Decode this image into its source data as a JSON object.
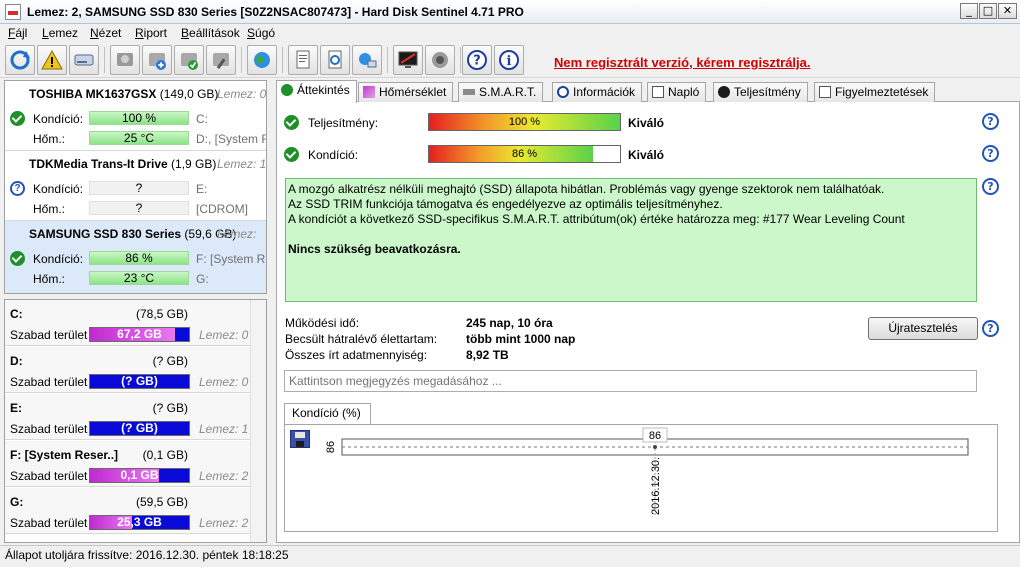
{
  "window": {
    "title": "Lemez: 2, SAMSUNG SSD 830 Series [S0Z2NSAC807473] - Hard Disk Sentinel 4.71 PRO",
    "btn_min": "_",
    "btn_max": "□",
    "btn_close": "✕"
  },
  "menu": [
    {
      "first": "F",
      "rest": "ájl"
    },
    {
      "first": "L",
      "rest": "emez"
    },
    {
      "first": "N",
      "rest": "ézet"
    },
    {
      "first": "R",
      "rest": "iport"
    },
    {
      "first": "B",
      "rest": "eállítások"
    },
    {
      "first": "S",
      "rest": "úgó"
    }
  ],
  "toolbar": {
    "icons": [
      "refresh-icon",
      "warning-icon",
      "disk-icon",
      "hdd-gray-icon",
      "hdd-add-icon",
      "hdd-ok-icon",
      "hdd-tool-icon",
      "globe-icon",
      "report-icon",
      "report-refresh-icon",
      "network-icon",
      "monitor-icon",
      "speaker-icon",
      "help-icon",
      "info-icon"
    ],
    "registration_warning": "Nem regisztrált verzió, kérem regisztrálja."
  },
  "disks": [
    {
      "name": "TOSHIBA MK1637GSX",
      "size": "(149,0 GB)",
      "lemez": "Lemez: 0",
      "status": "ok",
      "kondicio_label": "Kondíció:",
      "kondicio_value": "100 %",
      "hom_label": "Hőm.:",
      "hom_value": "25 °C",
      "drive1": "C:",
      "drive2": "D:, [System R"
    },
    {
      "name": "TDKMedia Trans-It Drive",
      "size": "(1,9 GB)",
      "lemez": "Lemez: 1",
      "status": "unknown",
      "kondicio_label": "Kondíció:",
      "kondicio_value": "?",
      "hom_label": "Hőm.:",
      "hom_value": "?",
      "drive1": "E:",
      "drive2": "[CDROM]"
    },
    {
      "name": "SAMSUNG SSD 830 Series",
      "size": "(59,6 GB)",
      "lemez": "Lemez:",
      "status": "ok",
      "kondicio_label": "Kondíció:",
      "kondicio_value": "86 %",
      "hom_label": "Hőm.:",
      "hom_value": "23 °C",
      "drive1": "F: [System Res",
      "drive2": "G:"
    }
  ],
  "partitions": [
    {
      "letter": "C:",
      "size": "(78,5 GB)",
      "free_label": "Szabad terület",
      "free_value": "67,2 GB",
      "fill": 0.86,
      "lemez": "Lemez: 0"
    },
    {
      "letter": "D:",
      "size": "(? GB)",
      "free_label": "Szabad terület",
      "free_value": "(? GB)",
      "fill": 0,
      "lemez": "Lemez: 0"
    },
    {
      "letter": "E:",
      "size": "(? GB)",
      "free_label": "Szabad terület",
      "free_value": "(? GB)",
      "fill": 0,
      "lemez": "Lemez: 1"
    },
    {
      "letter": "F: [System Reser..]",
      "size": "(0,1 GB)",
      "free_label": "Szabad terület",
      "free_value": "0,1 GB",
      "fill": 0.7,
      "lemez": "Lemez: 2"
    },
    {
      "letter": "G:",
      "size": "(59,5 GB)",
      "free_label": "Szabad terület",
      "free_value": "25,3 GB",
      "fill": 0.42,
      "lemez": "Lemez: 2"
    }
  ],
  "status_bar": "Állapot utoljára frissítve: 2016.12.30. péntek 18:18:25",
  "tabs": [
    {
      "label": "Áttekintés",
      "icon": "check-icon"
    },
    {
      "label": "Hőmérséklet",
      "icon": "thermometer-icon"
    },
    {
      "label": "S.M.A.R.T.",
      "icon": "smart-icon"
    },
    {
      "label": "Információk",
      "icon": "info-icon"
    },
    {
      "label": "Napló",
      "icon": "log-icon"
    },
    {
      "label": "Teljesítmény",
      "icon": "speed-icon"
    },
    {
      "label": "Figyelmeztetések",
      "icon": "alerts-icon"
    }
  ],
  "overview": {
    "performance_label": "Teljesítmény:",
    "performance_value": "100 %",
    "performance_fill": 1.0,
    "performance_rating": "Kiváló",
    "condition_label": "Kondíció:",
    "condition_value": "86 %",
    "condition_fill": 0.86,
    "condition_rating": "Kiváló",
    "description": [
      "A mozgó alkatrész nélküli meghajtó (SSD) állapota hibátlan. Problémás vagy gyenge szektorok nem találhatóak.",
      "Az SSD TRIM funkciója támogatva és engedélyezve az optimális teljesítményhez.",
      "A kondíciót a következő SSD-specifikus S.M.A.R.T. attribútum(ok) értéke határozza meg:  #177 Wear Leveling Count"
    ],
    "action": "Nincs szükség beavatkozásra.",
    "uptime_label": "Működési idő:",
    "uptime_value": "245 nap, 10 óra",
    "remaining_label": "Becsült hátralévő élettartam:",
    "remaining_value": "több mint 1000 nap",
    "written_label": "Összes írt adatmennyiség:",
    "written_value": "8,92 TB",
    "retest_button": "Újratesztelés",
    "note_placeholder": "Kattintson megjegyzés megadásához ...",
    "help": "?"
  },
  "chart_data": {
    "type": "line",
    "tab_label": "Kondíció  (%)",
    "x": [
      "2016.12.30."
    ],
    "series": [
      {
        "values": [
          86
        ]
      }
    ],
    "ylabel_tick": "86",
    "data_label": "86"
  }
}
